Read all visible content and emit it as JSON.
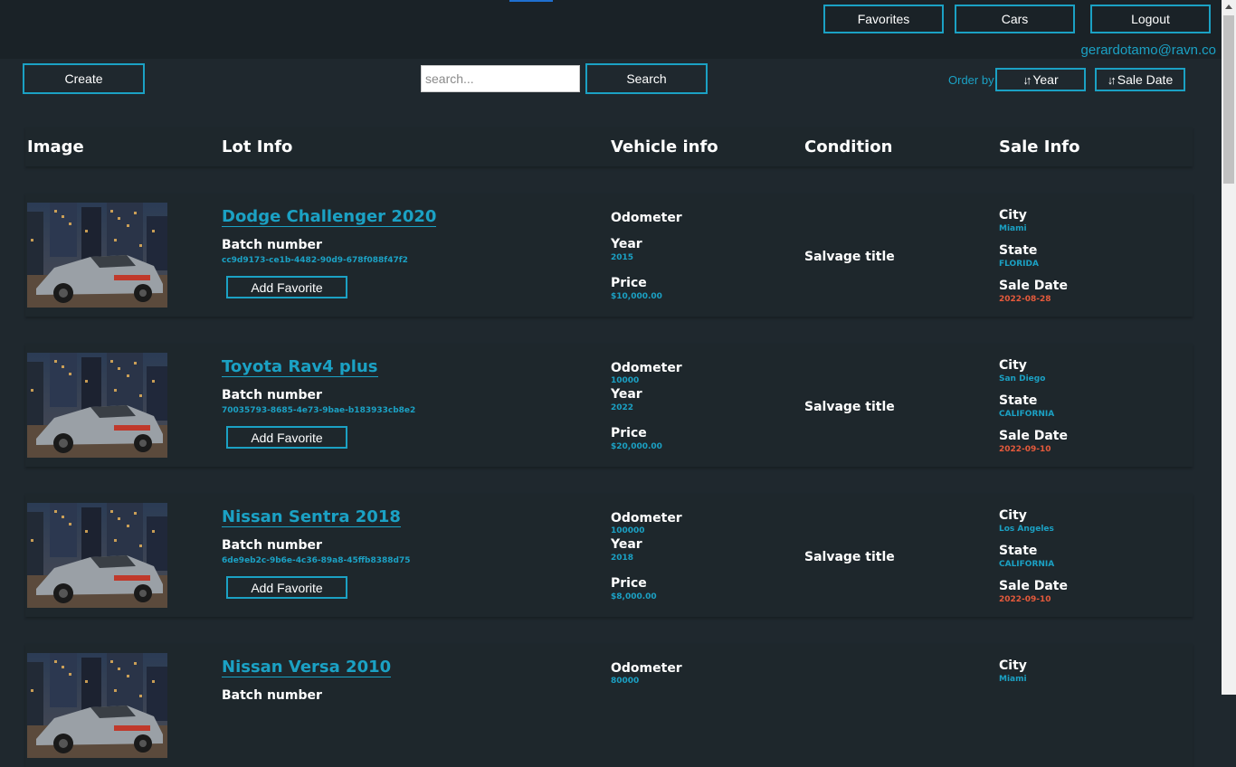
{
  "nav": {
    "favorites_label": "Favorites",
    "cars_label": "Cars",
    "logout_label": "Logout",
    "user_email": "gerardotamo@ravn.co"
  },
  "toolbar": {
    "create_label": "Create",
    "search_placeholder": "search...",
    "search_value": "",
    "search_button_label": "Search",
    "order_by_label": "Order by",
    "sort_year_label": "Year",
    "sort_sale_date_label": "Sale Date"
  },
  "table": {
    "headers": {
      "image": "Image",
      "lot_info": "Lot Info",
      "vehicle_info": "Vehicle info",
      "condition": "Condition",
      "sale_info": "Sale Info"
    },
    "labels": {
      "batch_number": "Batch number",
      "add_favorite": "Add Favorite",
      "odometer": "Odometer",
      "year": "Year",
      "price": "Price",
      "city": "City",
      "state": "State",
      "sale_date": "Sale Date"
    },
    "rows": [
      {
        "title": "Dodge Challenger 2020",
        "batch": "cc9d9173-ce1b-4482-90d9-678f088f47f2",
        "odometer": "",
        "year": "2015",
        "price": "$10,000.00",
        "condition": "Salvage title",
        "city": "Miami",
        "state": "FLORIDA",
        "sale_date": "2022-08-28"
      },
      {
        "title": "Toyota Rav4 plus",
        "batch": "70035793-8685-4e73-9bae-b183933cb8e2",
        "odometer": "10000",
        "year": "2022",
        "price": "$20,000.00",
        "condition": "Salvage title",
        "city": "San Diego",
        "state": "CALIFORNIA",
        "sale_date": "2022-09-10"
      },
      {
        "title": "Nissan Sentra 2018",
        "batch": "6de9eb2c-9b6e-4c36-89a8-45ffb8388d75",
        "odometer": "100000",
        "year": "2018",
        "price": "$8,000.00",
        "condition": "Salvage title",
        "city": "Los Angeles",
        "state": "CALIFORNIA",
        "sale_date": "2022-09-10"
      },
      {
        "title": "Nissan Versa 2010",
        "batch": "",
        "odometer": "80000",
        "year": "",
        "price": "",
        "condition": "",
        "city": "Miami",
        "state": "",
        "sale_date": ""
      }
    ]
  },
  "colors": {
    "background": "#1f282e",
    "topbar": "#1a2227",
    "accent": "#1ba1c4",
    "sale_date": "#e55a3c"
  }
}
